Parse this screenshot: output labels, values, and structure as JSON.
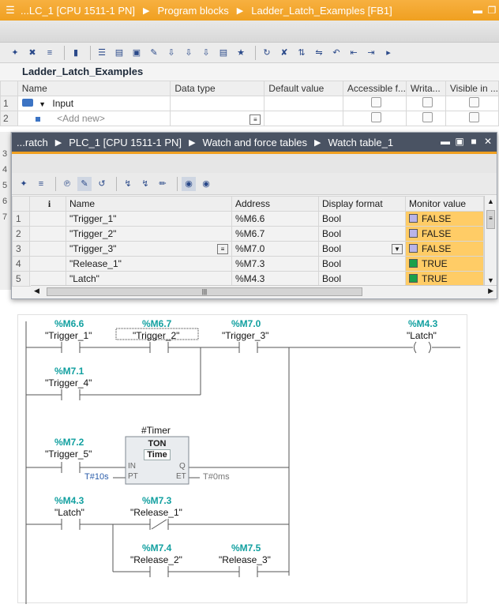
{
  "titlebar": {
    "crumbs": [
      "...LC_1 [CPU 1511-1 PN]",
      "Program blocks",
      "Ladder_Latch_Examples [FB1]"
    ]
  },
  "block_interface": {
    "title": "Ladder_Latch_Examples",
    "columns": [
      "Name",
      "Data type",
      "Default value",
      "Accessible f...",
      "Writa...",
      "Visible in ..."
    ],
    "rows": [
      {
        "num": "1",
        "name": "Input"
      },
      {
        "num": "2",
        "name": "<Add new>"
      }
    ],
    "hidden_row_numbers": [
      "3",
      "4",
      "5",
      "6",
      "7"
    ]
  },
  "watch_window": {
    "crumbs": [
      "...ratch",
      "PLC_1 [CPU 1511-1 PN]",
      "Watch and force tables",
      "Watch table_1"
    ],
    "columns": [
      "",
      "Name",
      "Address",
      "Display format",
      "Monitor value"
    ],
    "info_icon": "i",
    "rows": [
      {
        "num": "1",
        "name": "\"Trigger_1\"",
        "address": "%M6.6",
        "format": "Bool",
        "value": "FALSE"
      },
      {
        "num": "2",
        "name": "\"Trigger_2\"",
        "address": "%M6.7",
        "format": "Bool",
        "value": "FALSE"
      },
      {
        "num": "3",
        "name": "\"Trigger_3\"",
        "address": "%M7.0",
        "format": "Bool",
        "value": "FALSE"
      },
      {
        "num": "4",
        "name": "\"Release_1\"",
        "address": "%M7.3",
        "format": "Bool",
        "value": "TRUE"
      },
      {
        "num": "5",
        "name": "\"Latch\"",
        "address": "%M4.3",
        "format": "Bool",
        "value": "TRUE"
      }
    ],
    "colors": {
      "false_square": "#b9b4e8",
      "true_square": "#1aa04a",
      "monitor_bg": "#ffcc66"
    }
  },
  "ladder": {
    "contacts": [
      {
        "id": "t1",
        "address": "%M6.6",
        "tag": "\"Trigger_1\""
      },
      {
        "id": "t2",
        "address": "%M6.7",
        "tag": "\"Trigger_2\""
      },
      {
        "id": "t3",
        "address": "%M7.0",
        "tag": "\"Trigger_3\""
      },
      {
        "id": "t4",
        "address": "%M7.1",
        "tag": "\"Trigger_4\""
      },
      {
        "id": "t5",
        "address": "%M7.2",
        "tag": "\"Trigger_5\""
      },
      {
        "id": "latch_c",
        "address": "%M4.3",
        "tag": "\"Latch\""
      },
      {
        "id": "r1",
        "address": "%M7.3",
        "tag": "\"Release_1\""
      },
      {
        "id": "r2",
        "address": "%M7.4",
        "tag": "\"Release_2\""
      },
      {
        "id": "r3",
        "address": "%M7.5",
        "tag": "\"Release_3\""
      }
    ],
    "coil": {
      "address": "%M4.3",
      "tag": "\"Latch\""
    },
    "timer": {
      "instance": "#Timer",
      "type": "TON",
      "subtype": "Time",
      "in": "IN",
      "q": "Q",
      "pt": "PT",
      "et": "ET",
      "pt_value": "T#10s",
      "et_value": "T#0ms"
    }
  }
}
